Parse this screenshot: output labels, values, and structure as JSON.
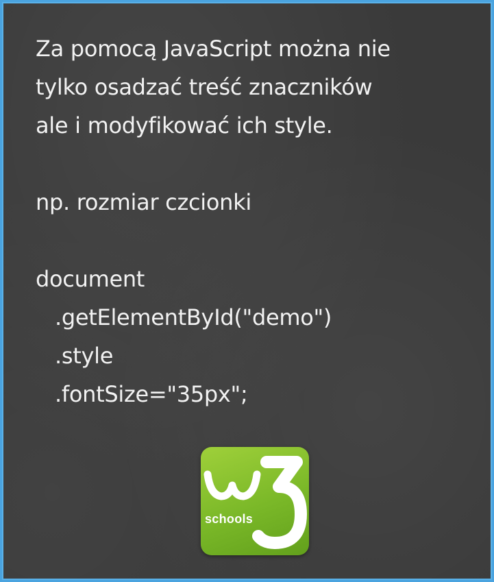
{
  "slide": {
    "intro_lines": [
      "Za pomocą JavaScript można nie",
      "tylko osadzać treść znaczników",
      "ale i modyfikować ich style."
    ],
    "example_label": "np. rozmiar czcionki",
    "code_lines": [
      "document",
      ".getElementById(\"demo\")",
      ".style",
      ".fontSize=\"35px\";"
    ]
  },
  "logo": {
    "label": "schools",
    "brand_color": "#7ab828"
  },
  "colors": {
    "board": "#3a3a3a",
    "frame": "#4aa3df",
    "text": "#f2f2f2"
  }
}
